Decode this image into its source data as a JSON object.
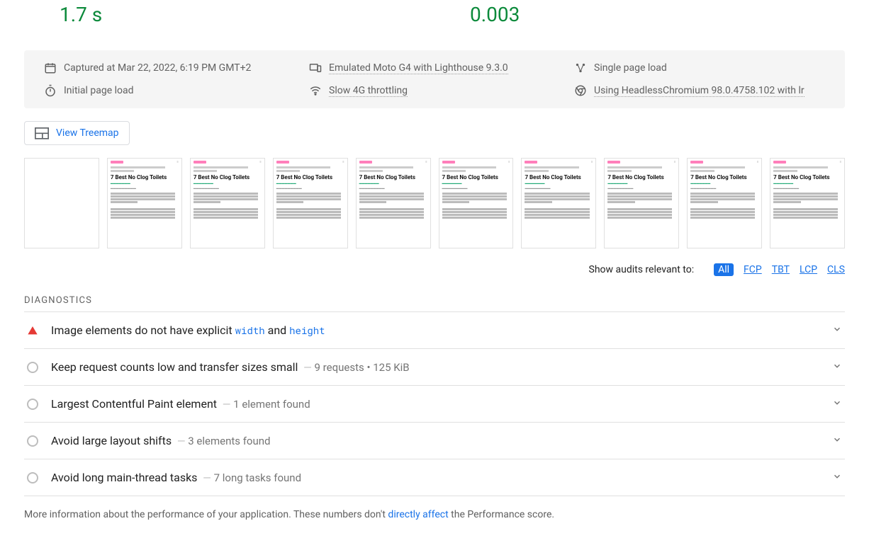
{
  "metrics": {
    "left_value": "1.7 s",
    "right_value": "0.003"
  },
  "env": {
    "captured": "Captured at Mar 22, 2022, 6:19 PM GMT+2",
    "device": "Emulated Moto G4 with Lighthouse 9.3.0",
    "loadtype": "Single page load",
    "nav": "Initial page load",
    "network": "Slow 4G throttling",
    "browser": "Using HeadlessChromium 98.0.4758.102 with lr"
  },
  "treemap": {
    "label": "View Treemap"
  },
  "filmstrip": {
    "thumb_title": "7 Best No Clog Toilets"
  },
  "filters": {
    "label": "Show audits relevant to:",
    "items": [
      "All",
      "FCP",
      "TBT",
      "LCP",
      "CLS"
    ],
    "active": "All"
  },
  "section_heading": "DIAGNOSTICS",
  "audits": [
    {
      "status": "warn",
      "title_pre": "Image elements do not have explicit ",
      "code1": "width",
      "mid": " and ",
      "code2": "height",
      "extra": ""
    },
    {
      "status": "info",
      "title_pre": "Keep request counts low and transfer sizes small",
      "code1": "",
      "mid": "",
      "code2": "",
      "extra": "9 requests • 125 KiB"
    },
    {
      "status": "info",
      "title_pre": "Largest Contentful Paint element",
      "code1": "",
      "mid": "",
      "code2": "",
      "extra": "1 element found"
    },
    {
      "status": "info",
      "title_pre": "Avoid large layout shifts",
      "code1": "",
      "mid": "",
      "code2": "",
      "extra": "3 elements found"
    },
    {
      "status": "info",
      "title_pre": "Avoid long main-thread tasks",
      "code1": "",
      "mid": "",
      "code2": "",
      "extra": "7 long tasks found"
    }
  ],
  "footnote": {
    "pre": "More information about the performance of your application. These numbers don't ",
    "link": "directly affect",
    "post": " the Performance score."
  }
}
